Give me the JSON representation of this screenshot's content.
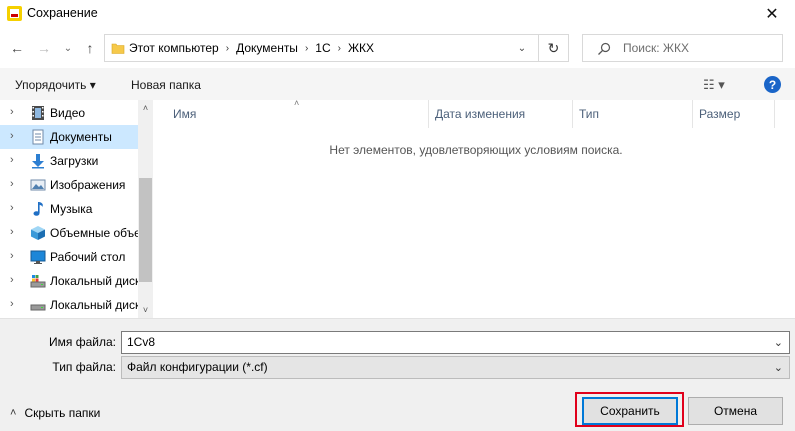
{
  "window": {
    "title": "Сохранение",
    "close_glyph": "✕"
  },
  "nav": {
    "back_glyph": "←",
    "forward_glyph": "→",
    "recent_glyph": "⌄",
    "up_glyph": "↑"
  },
  "address": {
    "crumbs": [
      "Этот компьютер",
      "Документы",
      "1С",
      "ЖКХ"
    ],
    "sep_glyph": "›",
    "drop_glyph": "⌄",
    "refresh_glyph": "↻"
  },
  "search": {
    "placeholder": "Поиск: ЖКХ"
  },
  "toolbar": {
    "organize_label": "Упорядочить ▾",
    "new_folder_label": "Новая папка",
    "view_glyph": "☷ ▾",
    "help_glyph": "?"
  },
  "tree": {
    "items": [
      {
        "label": "Видео",
        "icon": "video-icon",
        "selected": false
      },
      {
        "label": "Документы",
        "icon": "documents-icon",
        "selected": true
      },
      {
        "label": "Загрузки",
        "icon": "downloads-icon",
        "selected": false
      },
      {
        "label": "Изображения",
        "icon": "pictures-icon",
        "selected": false
      },
      {
        "label": "Музыка",
        "icon": "music-icon",
        "selected": false
      },
      {
        "label": "Объемные объекты",
        "icon": "3d-objects-icon",
        "selected": false
      },
      {
        "label": "Рабочий стол",
        "icon": "desktop-icon",
        "selected": false
      },
      {
        "label": "Локальный диск",
        "icon": "local-disk-icon",
        "selected": false
      },
      {
        "label": "Локальный диск",
        "icon": "local-disk-icon",
        "selected": false
      }
    ],
    "chevron_glyph": "›",
    "scroll_up_glyph": "˄",
    "scroll_down_glyph": "˅"
  },
  "filelist": {
    "columns": [
      "Имя",
      "Дата изменения",
      "Тип",
      "Размер"
    ],
    "sort_glyph": "˄",
    "empty_message": "Нет элементов, удовлетворяющих условиям поиска."
  },
  "form": {
    "filename_label": "Имя файла:",
    "filename_value": "1Cv8",
    "filetype_label": "Тип файла:",
    "filetype_value": "Файл конфигурации (*.cf)",
    "drop_glyph": "⌄"
  },
  "footer": {
    "hide_folders_label": "Скрыть папки",
    "hide_glyph": "˄",
    "save_label": "Сохранить",
    "cancel_label": "Отмена"
  },
  "colors": {
    "selection": "#cce8ff",
    "primary_border": "#0078d7",
    "highlight": "#e0001b"
  }
}
